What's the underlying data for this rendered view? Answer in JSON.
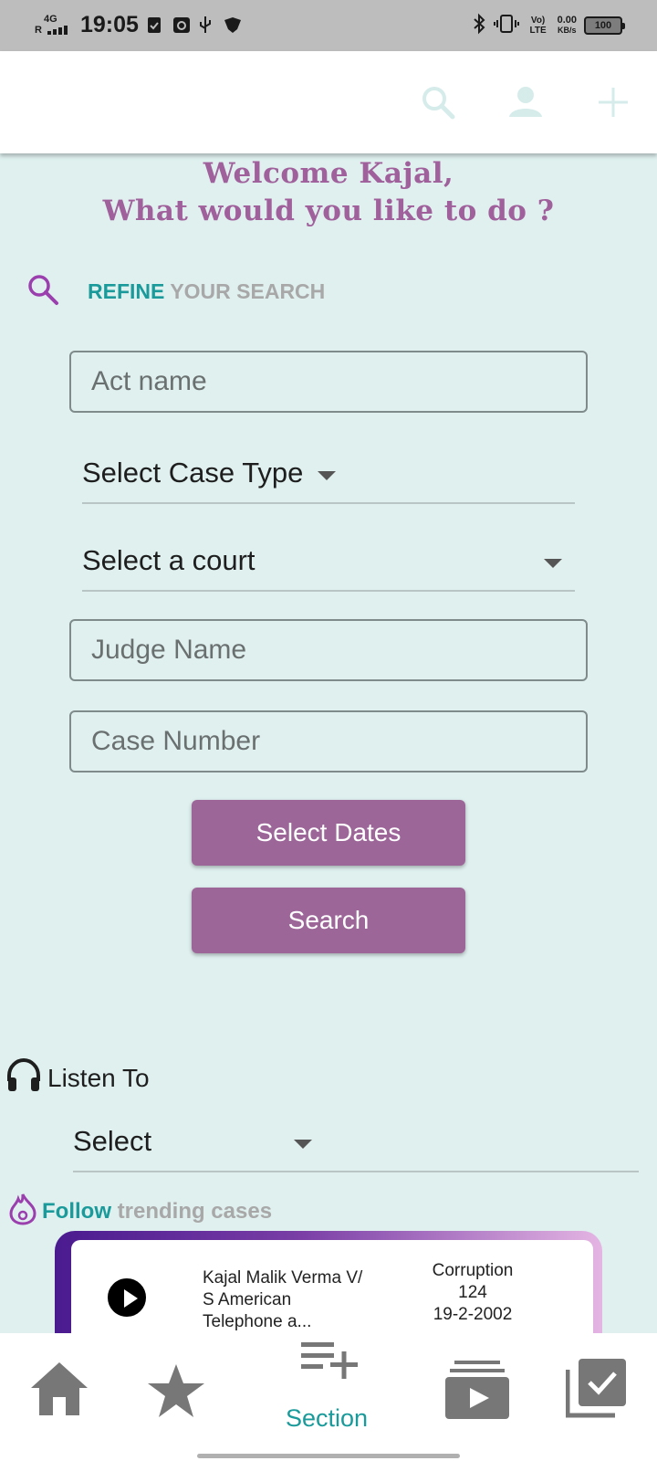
{
  "status_bar": {
    "time": "19:05",
    "network": "4G",
    "roaming": "R",
    "volte": "Vo) LTE",
    "speed_value": "0.00",
    "speed_unit": "KB/s",
    "battery": "100"
  },
  "welcome": {
    "line1": "Welcome Kajal,",
    "line2": "What would you like to do ?"
  },
  "refine": {
    "label_highlight": "REFINE",
    "label_rest": " YOUR SEARCH"
  },
  "form": {
    "act_placeholder": "Act name",
    "case_type": "Select Case Type",
    "court": "Select a court",
    "judge_placeholder": "Judge Name",
    "case_number_placeholder": "Case Number",
    "dates_button": "Select Dates",
    "search_button": "Search"
  },
  "listen": {
    "label": "Listen To",
    "select": "Select"
  },
  "follow": {
    "label_highlight": "Follow",
    "label_rest": " trending cases"
  },
  "trending_case": {
    "title_line1": "Kajal Malik Verma V/",
    "title_line2": "S American",
    "title_line3": "Telephone a...",
    "category": "Corruption",
    "number": "124",
    "date": "19-2-2002"
  },
  "bottom_nav": {
    "active_label": "Section"
  },
  "colors": {
    "accent_purple": "#9d6699",
    "accent_teal": "#1a9a9a",
    "background": "#dff0ef"
  }
}
